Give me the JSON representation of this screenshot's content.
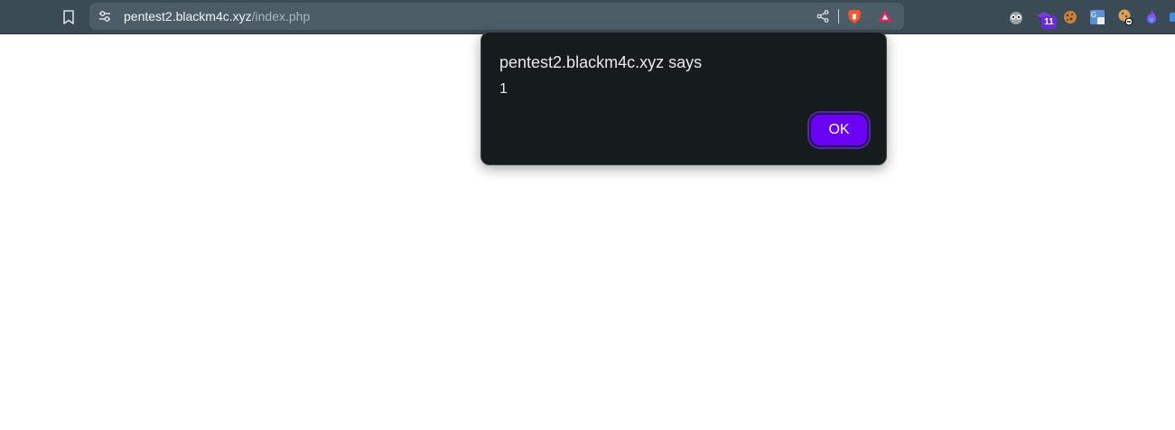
{
  "address_bar": {
    "host": "pentest2.blackm4c.xyz",
    "path": "/index.php"
  },
  "extensions": {
    "badge_count": "11"
  },
  "dialog": {
    "title": "pentest2.blackm4c.xyz says",
    "message": "1",
    "ok_label": "OK"
  },
  "colors": {
    "toolbar": "#3b4b55",
    "urlbar": "#4d5d67",
    "dialog_bg": "#161b1e",
    "ok_button": "#6a00f4"
  },
  "icons": [
    "bookmark-icon",
    "site-info-icon",
    "share-icon",
    "brave-shield-icon",
    "brave-rewards-icon",
    "extension-icons"
  ]
}
